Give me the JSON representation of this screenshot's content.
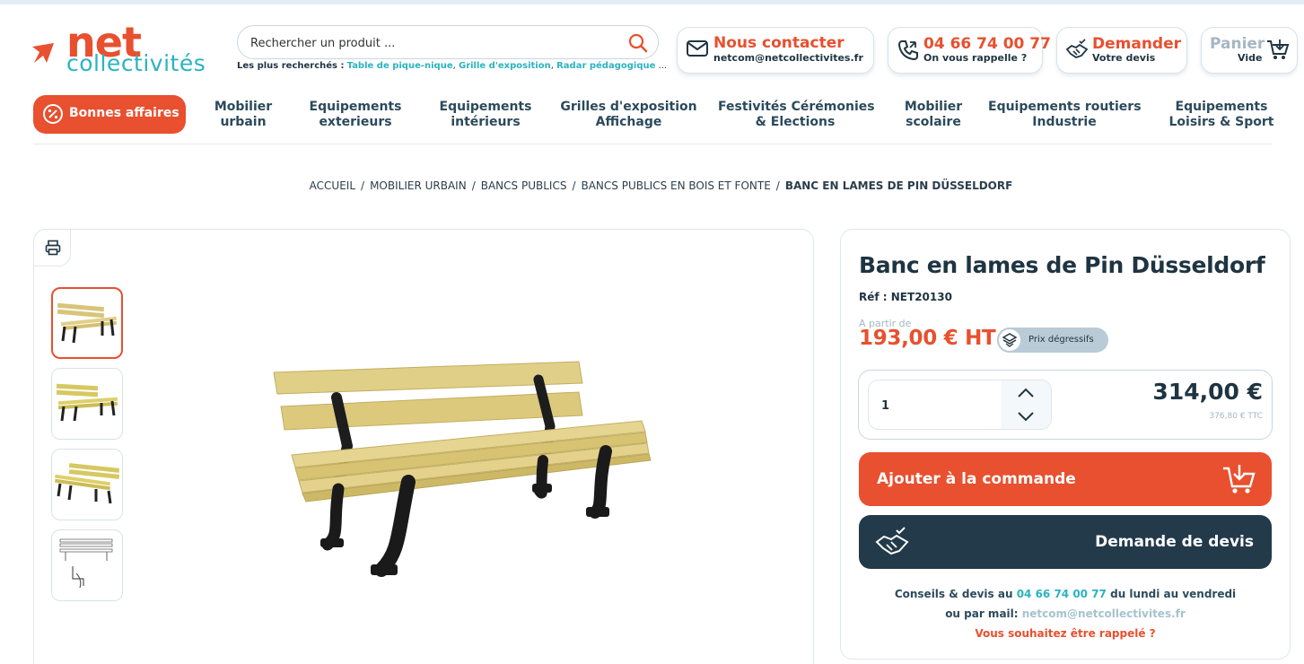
{
  "brand": {
    "logo_net": "net",
    "logo_collectivites": "collectivités",
    "accent": "#e8502f",
    "teal": "#2bb3c0",
    "dark": "#233a4a"
  },
  "search": {
    "placeholder": "Rechercher un produit ...",
    "popular_label": "Les plus recherchés :",
    "popular_links": [
      "Table de pique-nique",
      "Grille d'exposition",
      "Radar pédagogique",
      "..."
    ]
  },
  "header": {
    "contact_title": "Nous contacter",
    "contact_email": "netcom@netcollectivites.fr",
    "phone_number": "04 66 74 00 77",
    "phone_sub": "On vous rappelle ?",
    "quote_title": "Demander",
    "quote_sub": "Votre devis",
    "cart_title": "Panier",
    "cart_sub": "Vide"
  },
  "nav": {
    "deals_label": "Bonnes affaires",
    "items": [
      {
        "line1": "Mobilier",
        "line2": "urbain"
      },
      {
        "line1": "Equipements",
        "line2": "exterieurs"
      },
      {
        "line1": "Equipements",
        "line2": "intérieurs"
      },
      {
        "line1": "Grilles d'exposition",
        "line2": "Affichage"
      },
      {
        "line1": "Festivités Cérémonies",
        "line2": "& Elections"
      },
      {
        "line1": "Mobilier",
        "line2": "scolaire"
      },
      {
        "line1": "Equipements routiers",
        "line2": "Industrie"
      },
      {
        "line1": "Equipements",
        "line2": "Loisirs & Sport"
      }
    ]
  },
  "breadcrumb": [
    "ACCUEIL",
    "MOBILIER URBAIN",
    "BANCS PUBLICS",
    "BANCS PUBLICS EN BOIS ET FONTE",
    "BANC EN LAMES DE PIN DÜSSELDORF"
  ],
  "product": {
    "title": "Banc en lames de Pin Düsseldorf",
    "ref_label": "Réf :",
    "ref_value": "NET20130",
    "from_label": "A partir de",
    "price": "193,00 € HT",
    "degressive_label": "Prix dégressifs",
    "quantity": "1",
    "total": "314,00 €",
    "total_ttc": "376,80 € TTC",
    "order_button": "Ajouter à la commande",
    "quote_button": "Demande de devis"
  },
  "advice": {
    "line1_prefix": "Conseils & devis au",
    "phone": "04 66 74 00 77",
    "line1_suffix": "du lundi au vendredi",
    "line2_prefix": "ou par mail:",
    "email": "netcom@netcollectivites.fr",
    "callback": "Vous souhaitez être rappelé ?"
  },
  "icons": [
    "print-icon",
    "search-icon",
    "mail-icon",
    "phone-icon",
    "handshake-icon",
    "cart-icon",
    "percent-badge-icon",
    "layers-icon",
    "chevron-up-icon",
    "chevron-down-icon",
    "cart-add-icon"
  ]
}
